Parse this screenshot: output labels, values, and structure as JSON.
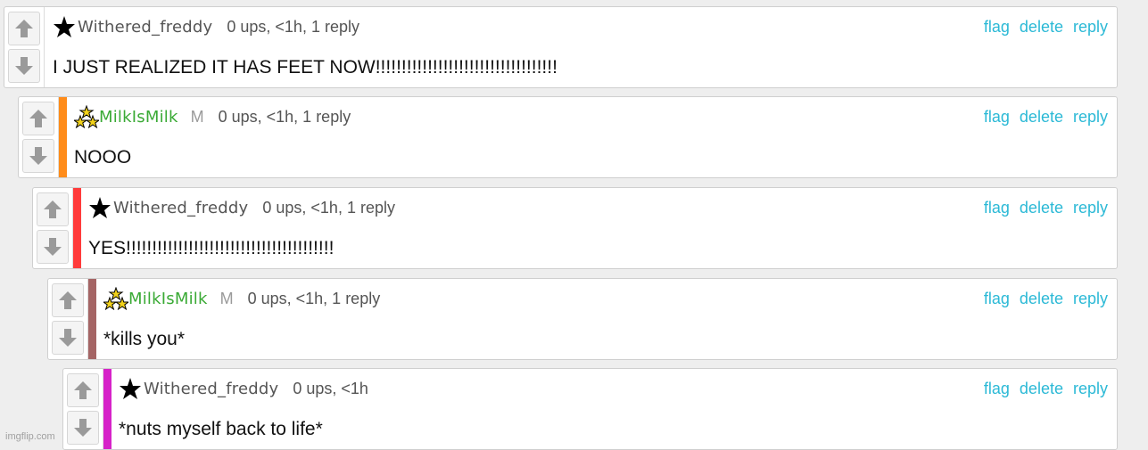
{
  "colors": {
    "action_link": "#2bb9d6",
    "depth_bar_1": "#ff8c1a",
    "depth_bar_2": "#ff3b3b",
    "depth_bar_3": "#a56565",
    "depth_bar_4": "#d622c8",
    "username_default": "#555555",
    "username_mod": "#3aaa35"
  },
  "actions": {
    "flag": "flag",
    "delete": "delete",
    "reply": "reply"
  },
  "comments": [
    {
      "username": "Withered_freddy",
      "user_badge_icon": "black-star-icon",
      "is_mod": false,
      "meta": "0 ups, <1h, 1 reply",
      "text": "I JUST REALIZED IT HAS FEET NOW!!!!!!!!!!!!!!!!!!!!!!!!!!!!!!!!!!!"
    },
    {
      "username": "MilkIsMilk",
      "user_badge_icon": "triple-star-icon",
      "is_mod": true,
      "mod_label": "M",
      "meta": "0 ups, <1h, 1 reply",
      "text": "NOOO"
    },
    {
      "username": "Withered_freddy",
      "user_badge_icon": "black-star-icon",
      "is_mod": false,
      "meta": "0 ups, <1h, 1 reply",
      "text": "YES!!!!!!!!!!!!!!!!!!!!!!!!!!!!!!!!!!!!!!!!"
    },
    {
      "username": "MilkIsMilk",
      "user_badge_icon": "triple-star-icon",
      "is_mod": true,
      "mod_label": "M",
      "meta": "0 ups, <1h, 1 reply",
      "text": "*kills you*"
    },
    {
      "username": "Withered_freddy",
      "user_badge_icon": "black-star-icon",
      "is_mod": false,
      "meta": "0 ups, <1h",
      "text": "*nuts myself back to life*"
    }
  ],
  "watermark": "imgflip.com"
}
